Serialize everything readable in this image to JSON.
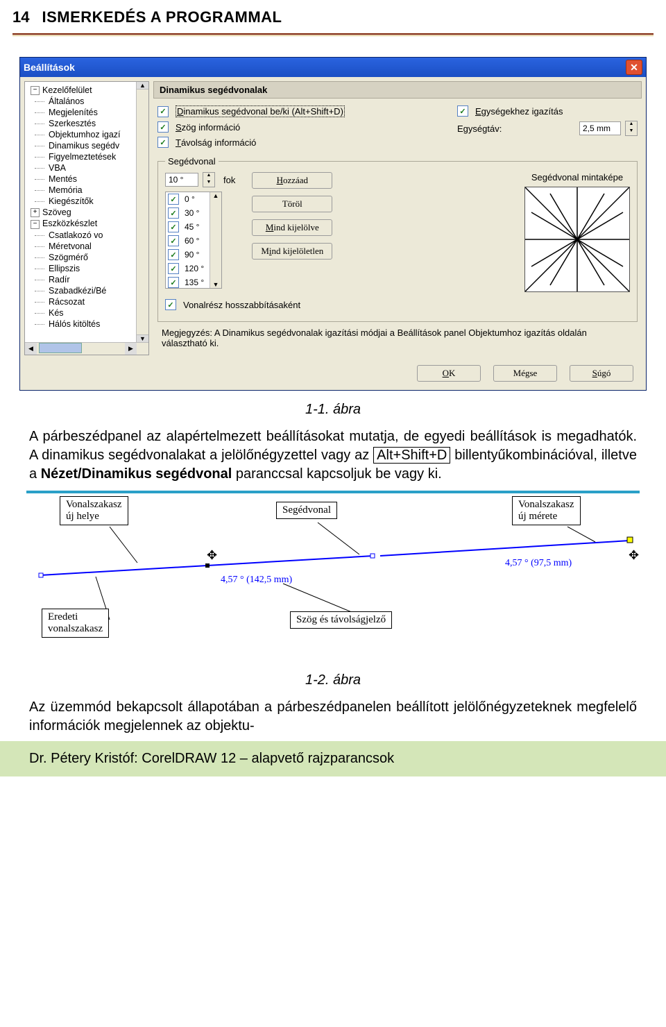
{
  "header": {
    "page_num": "14",
    "title": "ISMERKEDÉS A PROGRAMMAL"
  },
  "dialog": {
    "title": "Beállítások",
    "tree": [
      {
        "lvl": 1,
        "twist": "−",
        "label": "Kezelőfelület"
      },
      {
        "lvl": 2,
        "label": "Általános"
      },
      {
        "lvl": 2,
        "label": "Megjelenítés"
      },
      {
        "lvl": 2,
        "label": "Szerkesztés"
      },
      {
        "lvl": 2,
        "label": "Objektumhoz igazí"
      },
      {
        "lvl": 2,
        "label": "Dinamikus segédv"
      },
      {
        "lvl": 2,
        "label": "Figyelmeztetések"
      },
      {
        "lvl": 2,
        "label": "VBA"
      },
      {
        "lvl": 2,
        "label": "Mentés"
      },
      {
        "lvl": 2,
        "label": "Memória"
      },
      {
        "lvl": 2,
        "label": "Kiegészítők"
      },
      {
        "lvl": 1,
        "twist": "+",
        "label": "Szöveg"
      },
      {
        "lvl": 1,
        "twist": "−",
        "label": "Eszközkészlet"
      },
      {
        "lvl": 2,
        "label": "Csatlakozó vo"
      },
      {
        "lvl": 2,
        "label": "Méretvonal"
      },
      {
        "lvl": 2,
        "label": "Szögmérő"
      },
      {
        "lvl": 2,
        "label": "Ellipszis"
      },
      {
        "lvl": 2,
        "label": "Radír"
      },
      {
        "lvl": 2,
        "label": "Szabadkézi/Bé"
      },
      {
        "lvl": 2,
        "label": "Rácsozat"
      },
      {
        "lvl": 2,
        "label": "Kés"
      },
      {
        "lvl": 2,
        "label": "Hálós kitöltés"
      }
    ],
    "pane_title": "Dinamikus segédvonalak",
    "chk_dynamic": "Dinamikus segédvonal be/ki (Alt+Shift+D)",
    "chk_units": "Egységekhez igazítás",
    "chk_angle": "Szög információ",
    "lbl_gap": "Egységtáv:",
    "val_gap": "2,5 mm",
    "chk_dist": "Távolság információ",
    "fs_legend": "Segédvonal",
    "deg_val": "10 °",
    "deg_unit": "fok",
    "angles": [
      {
        "on": true,
        "v": "0 °"
      },
      {
        "on": true,
        "v": "30 °"
      },
      {
        "on": true,
        "v": "45 °"
      },
      {
        "on": true,
        "v": "60 °"
      },
      {
        "on": true,
        "v": "90 °"
      },
      {
        "on": true,
        "v": "120 °"
      },
      {
        "on": true,
        "v": "135 °"
      }
    ],
    "btn_add": "Hozzáad",
    "btn_del": "Töröl",
    "btn_all": "Mind kijelölve",
    "btn_none": "Mind kijelöletlen",
    "preview_lbl": "Segédvonal mintaképe",
    "chk_extend": "Vonalrész hosszabbításaként",
    "note_lbl": "Megjegyzés:",
    "note_txt": "A Dinamikus segédvonalak igazítási módjai a Beállítások panel Objektumhoz igazítás oldalán választható ki.",
    "btn_ok": "OK",
    "btn_cancel": "Mégse",
    "btn_help": "Súgó"
  },
  "caption1": "1-1. ábra",
  "para1": "A párbeszédpanel az alapértelmezett beállításokat mutatja, de egyedi beállítások is megadhatók. A dinamikus segédvonalakat a jelölőnégyzettel vagy az ",
  "keycombo": "Alt+Shift+D",
  "para1b": " billentyűkombinációval, illetve a ",
  "para1c": "Nézet/Dinamikus segédvonal",
  "para1d": " paranccsal kapcsoljuk be vagy ki.",
  "fig2": {
    "c1": "Vonalszakasz\núj helye",
    "c2": "Segédvonal",
    "c3": "Vonalszakasz\núj mérete",
    "c4": "Eredeti\nvonalszakasz",
    "c5": "Szög és távolságjelző",
    "m1": "4,57 °  (142,5 mm)",
    "m2": "4,57 °  (97,5 mm)"
  },
  "caption2": "1-2. ábra",
  "para2": "Az üzemmód bekapcsolt állapotában a párbeszédpanelen beállított jelölőnégyzeteknek megfelelő információk megjelennek az objektu-",
  "footer": "Dr. Pétery Kristóf: CorelDRAW 12 – alapvető rajzparancsok"
}
